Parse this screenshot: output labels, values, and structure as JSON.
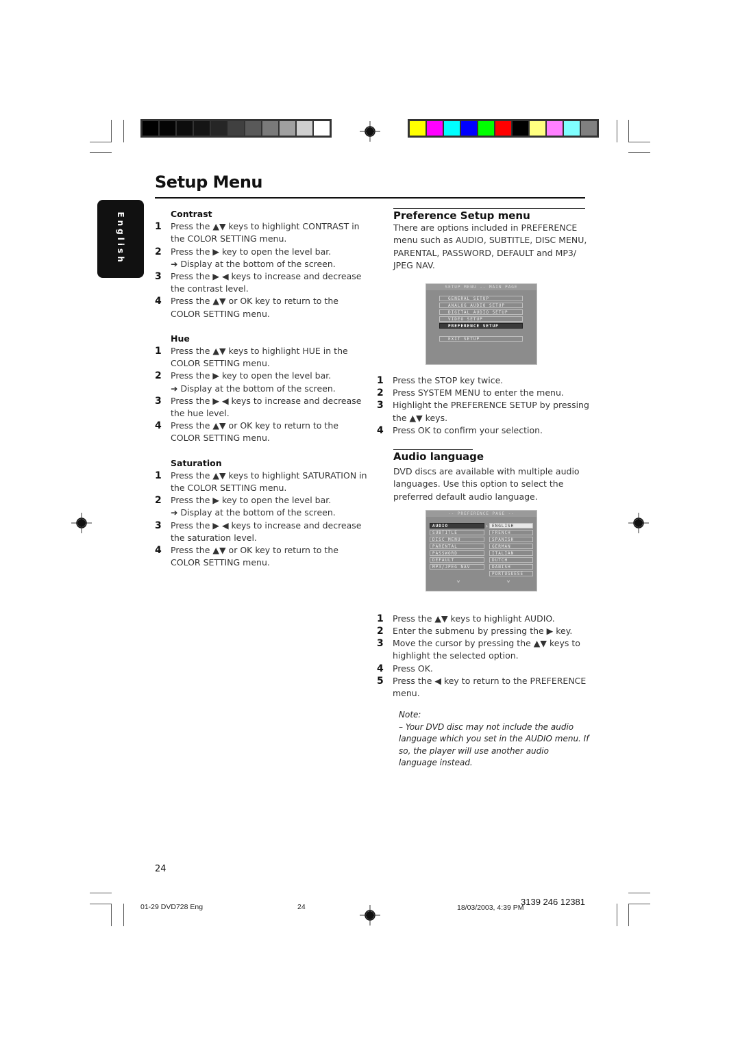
{
  "print_marks": {
    "grayscale_bar": [
      "#000000",
      "#050505",
      "#0d0d0d",
      "#151515",
      "#262626",
      "#404040",
      "#595959",
      "#7a7a7a",
      "#a0a0a0",
      "#cfcfcf",
      "#ffffff"
    ],
    "color_bar": [
      "#ffff00",
      "#ff00ff",
      "#00ffff",
      "#0000ff",
      "#00ff00",
      "#ff0000",
      "#000000",
      "#ffff80",
      "#ff80ff",
      "#80ffff",
      "#808080"
    ]
  },
  "page": {
    "title": "Setup Menu",
    "language_tab": "English",
    "page_number": "24"
  },
  "left_column": {
    "sections": [
      {
        "heading": "Contrast",
        "steps": [
          {
            "num": "1",
            "text": "Press the ▲▼ keys to highlight CONTRAST in the COLOR SETTING menu."
          },
          {
            "num": "2",
            "text": "Press the ▶ key to open the level bar.",
            "result": "➜  Display at the bottom of the screen."
          },
          {
            "num": "3",
            "text": "Press the ▶ ◀ keys to increase and decrease the contrast level."
          },
          {
            "num": "4",
            "text": "Press the ▲▼ or OK key to return to the COLOR SETTING menu."
          }
        ]
      },
      {
        "heading": "Hue",
        "steps": [
          {
            "num": "1",
            "text": "Press the ▲▼ keys to highlight HUE in the COLOR SETTING menu."
          },
          {
            "num": "2",
            "text": "Press the ▶ key to open the level bar.",
            "result": "➜  Display at the bottom of the screen."
          },
          {
            "num": "3",
            "text": "Press the ▶ ◀ keys to increase and decrease the hue level."
          },
          {
            "num": "4",
            "text": "Press the ▲▼ or OK key to return to the COLOR SETTING menu."
          }
        ]
      },
      {
        "heading": "Saturation",
        "steps": [
          {
            "num": "1",
            "text": "Press the ▲▼ keys to highlight SATURATION in the COLOR SETTING menu."
          },
          {
            "num": "2",
            "text": "Press the ▶ key to open the level bar.",
            "result": "➜  Display at the bottom of the screen."
          },
          {
            "num": "3",
            "text": "Press the ▶ ◀ keys to increase and decrease the saturation level."
          },
          {
            "num": "4",
            "text": "Press the ▲▼ or OK key to return to the COLOR SETTING menu."
          }
        ]
      }
    ]
  },
  "right_column": {
    "preference": {
      "title": "Preference Setup menu",
      "intro": "There are options included in PREFERENCE menu such as AUDIO, SUBTITLE, DISC MENU, PARENTAL, PASSWORD,  DEFAULT and MP3/ JPEG NAV.",
      "screen": {
        "header": "SETUP MENU -- MAIN PAGE",
        "items": [
          "GENERAL SETUP",
          "ANALOG AUDIO SETUP",
          "DIGITAL AUDIO SETUP",
          "VIDEO SETUP",
          "PREFERENCE SETUP"
        ],
        "selected": "PREFERENCE SETUP",
        "exit": "EXIT SETUP"
      },
      "steps": [
        {
          "num": "1",
          "text": "Press the STOP key twice."
        },
        {
          "num": "2",
          "text": "Press SYSTEM MENU to enter the menu."
        },
        {
          "num": "3",
          "text": "Highlight the PREFERENCE SETUP by pressing the ▲▼ keys."
        },
        {
          "num": "4",
          "text": "Press OK to confirm your selection."
        }
      ]
    },
    "audio": {
      "title": "Audio language",
      "intro": "DVD discs are available with multiple audio languages. Use this option to select the preferred default audio language.",
      "screen": {
        "header": "-- PREFERENCE PAGE --",
        "left_items": [
          "AUDIO",
          "SUBTITLE",
          "DISC MENU",
          "PARENTAL",
          "PASSWORD",
          "DEFAULT",
          "MP3/JPEG NAV"
        ],
        "left_selected": "AUDIO",
        "right_items": [
          "ENGLISH",
          "FRENCH",
          "SPANISH",
          "GERMAN",
          "ITALIAN",
          "DUTCH",
          "DANISH",
          "PORTUGUESE"
        ],
        "right_highlighted": "ENGLISH"
      },
      "steps": [
        {
          "num": "1",
          "text": "Press the ▲▼ keys to highlight AUDIO."
        },
        {
          "num": "2",
          "text": "Enter the submenu by pressing the ▶  key."
        },
        {
          "num": "3",
          "text": "Move the cursor by pressing the ▲▼ keys to highlight the selected option."
        },
        {
          "num": "4",
          "text": "Press OK."
        },
        {
          "num": "5",
          "text": "Press the ◀ key to return to the PREFERENCE menu."
        }
      ],
      "note_label": "Note:",
      "note_text": "–    Your DVD disc may not include the audio language which you set in the AUDIO menu. If so, the player will use another audio language instead."
    }
  },
  "footer": {
    "file": "01-29 DVD728 Eng",
    "page": "24",
    "timestamp": "18/03/2003, 4:39 PM",
    "doc_number": "3139 246 12381"
  }
}
